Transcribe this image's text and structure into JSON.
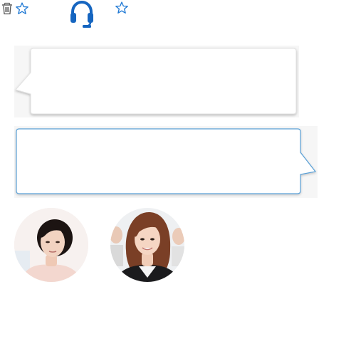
{
  "toolbar": {
    "icons": [
      "trash-icon",
      "star-outline-icon",
      "headset-icon",
      "star-outline-icon"
    ]
  },
  "colors": {
    "accent": "#1565c0",
    "bubble_border_right": "#5aa0d6",
    "bubble_fill": "#ffffff",
    "panel_background": "#f6f6f6"
  },
  "chat": {
    "messages": [
      {
        "side": "left",
        "text": ""
      },
      {
        "side": "right",
        "text": ""
      }
    ]
  },
  "avatars": [
    {
      "name": "avatar-woman-older"
    },
    {
      "name": "avatar-woman-younger"
    }
  ]
}
